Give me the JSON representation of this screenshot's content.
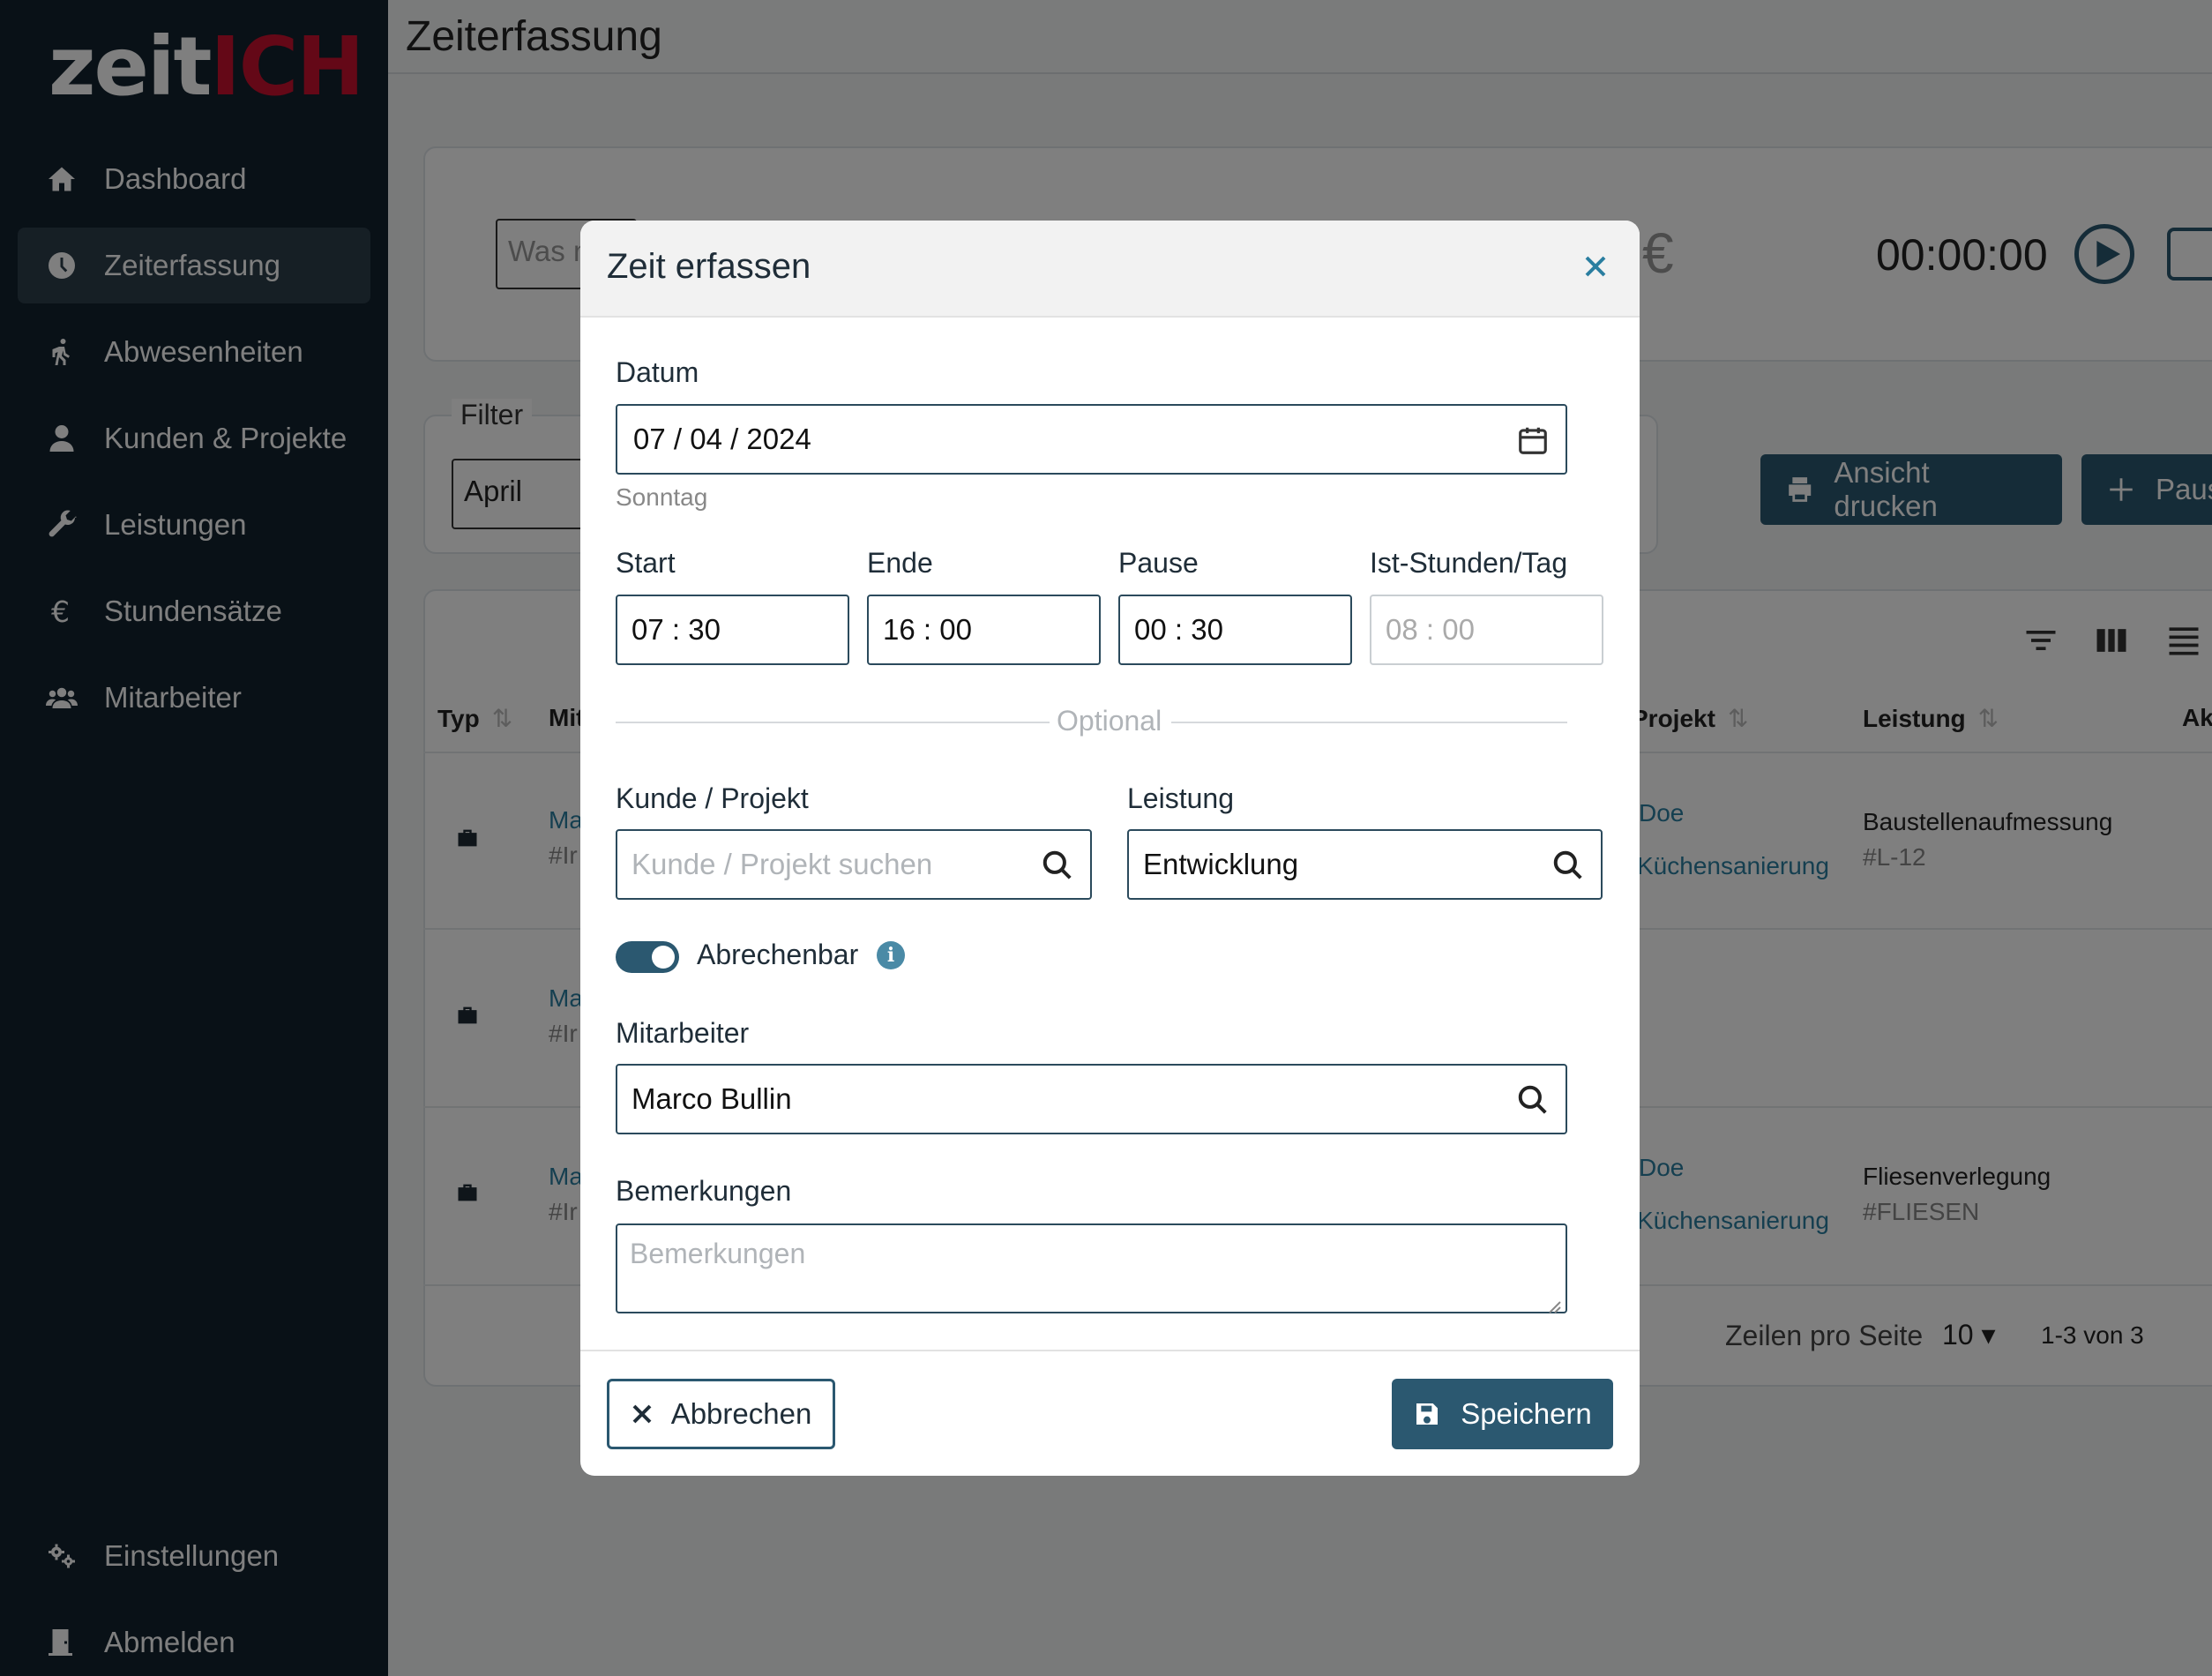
{
  "app": {
    "logo_part1": "zeit",
    "logo_part2": "ICH",
    "page_title": "Zeiterfassung"
  },
  "sidebar": {
    "items": [
      {
        "label": "Dashboard",
        "icon": "home-icon"
      },
      {
        "label": "Zeiterfassung",
        "icon": "clock-icon",
        "active": true
      },
      {
        "label": "Abwesenheiten",
        "icon": "walking-icon"
      },
      {
        "label": "Kunden & Projekte",
        "icon": "user-icon"
      },
      {
        "label": "Leistungen",
        "icon": "wrench-icon"
      },
      {
        "label": "Stundensätze",
        "icon": "euro-icon"
      },
      {
        "label": "Mitarbeiter",
        "icon": "users-icon"
      }
    ],
    "bottom": [
      {
        "label": "Einstellungen",
        "icon": "gears-icon"
      },
      {
        "label": "Abmelden",
        "icon": "door-icon"
      }
    ]
  },
  "background": {
    "quick_entry_placeholder": "Was m",
    "euro_symbol": "€",
    "timer": "00:00:00",
    "filter_legend": "Filter",
    "filter_month": "April",
    "print_button": "Ansicht drucken",
    "pause_button": "Paus",
    "columns": [
      "Typ",
      "Mit",
      "Projekt",
      "Leistung",
      "Ak"
    ],
    "rows": [
      {
        "emp": "Ma",
        "emp_id": "#Ir",
        "customer": "Doe",
        "project": "Küchensanierung",
        "service": "Baustellenaufmessung",
        "service_code": "#L-12"
      },
      {
        "emp": "Ma",
        "emp_id": "#Ir",
        "customer": "",
        "project": "",
        "service": "",
        "service_code": ""
      },
      {
        "emp": "Ma",
        "emp_id": "#Ir",
        "customer": "Doe",
        "project": "Küchensanierung",
        "service": "Fliesenverlegung",
        "service_code": "#FLIESEN"
      }
    ],
    "rows_per_page_label": "Zeilen pro Seite",
    "rows_per_page_value": "10",
    "range": "1-3 von 3"
  },
  "modal": {
    "title": "Zeit erfassen",
    "date_label": "Datum",
    "date_value": "07 / 04 / 2024",
    "weekday": "Sonntag",
    "start_label": "Start",
    "start_value": "07 : 30",
    "end_label": "Ende",
    "end_value": "16 : 00",
    "pause_label": "Pause",
    "pause_value": "00 : 30",
    "hours_label": "Ist-Stunden/Tag",
    "hours_value": "08 : 00",
    "optional_label": "Optional",
    "customer_label": "Kunde / Projekt",
    "customer_placeholder": "Kunde / Projekt suchen",
    "service_label": "Leistung",
    "service_value": "Entwicklung",
    "billable_label": "Abrechenbar",
    "billable": true,
    "employee_label": "Mitarbeiter",
    "employee_value": "Marco Bullin",
    "remarks_label": "Bemerkungen",
    "remarks_placeholder": "Bemerkungen",
    "cancel_label": "Abbrechen",
    "save_label": "Speichern"
  }
}
